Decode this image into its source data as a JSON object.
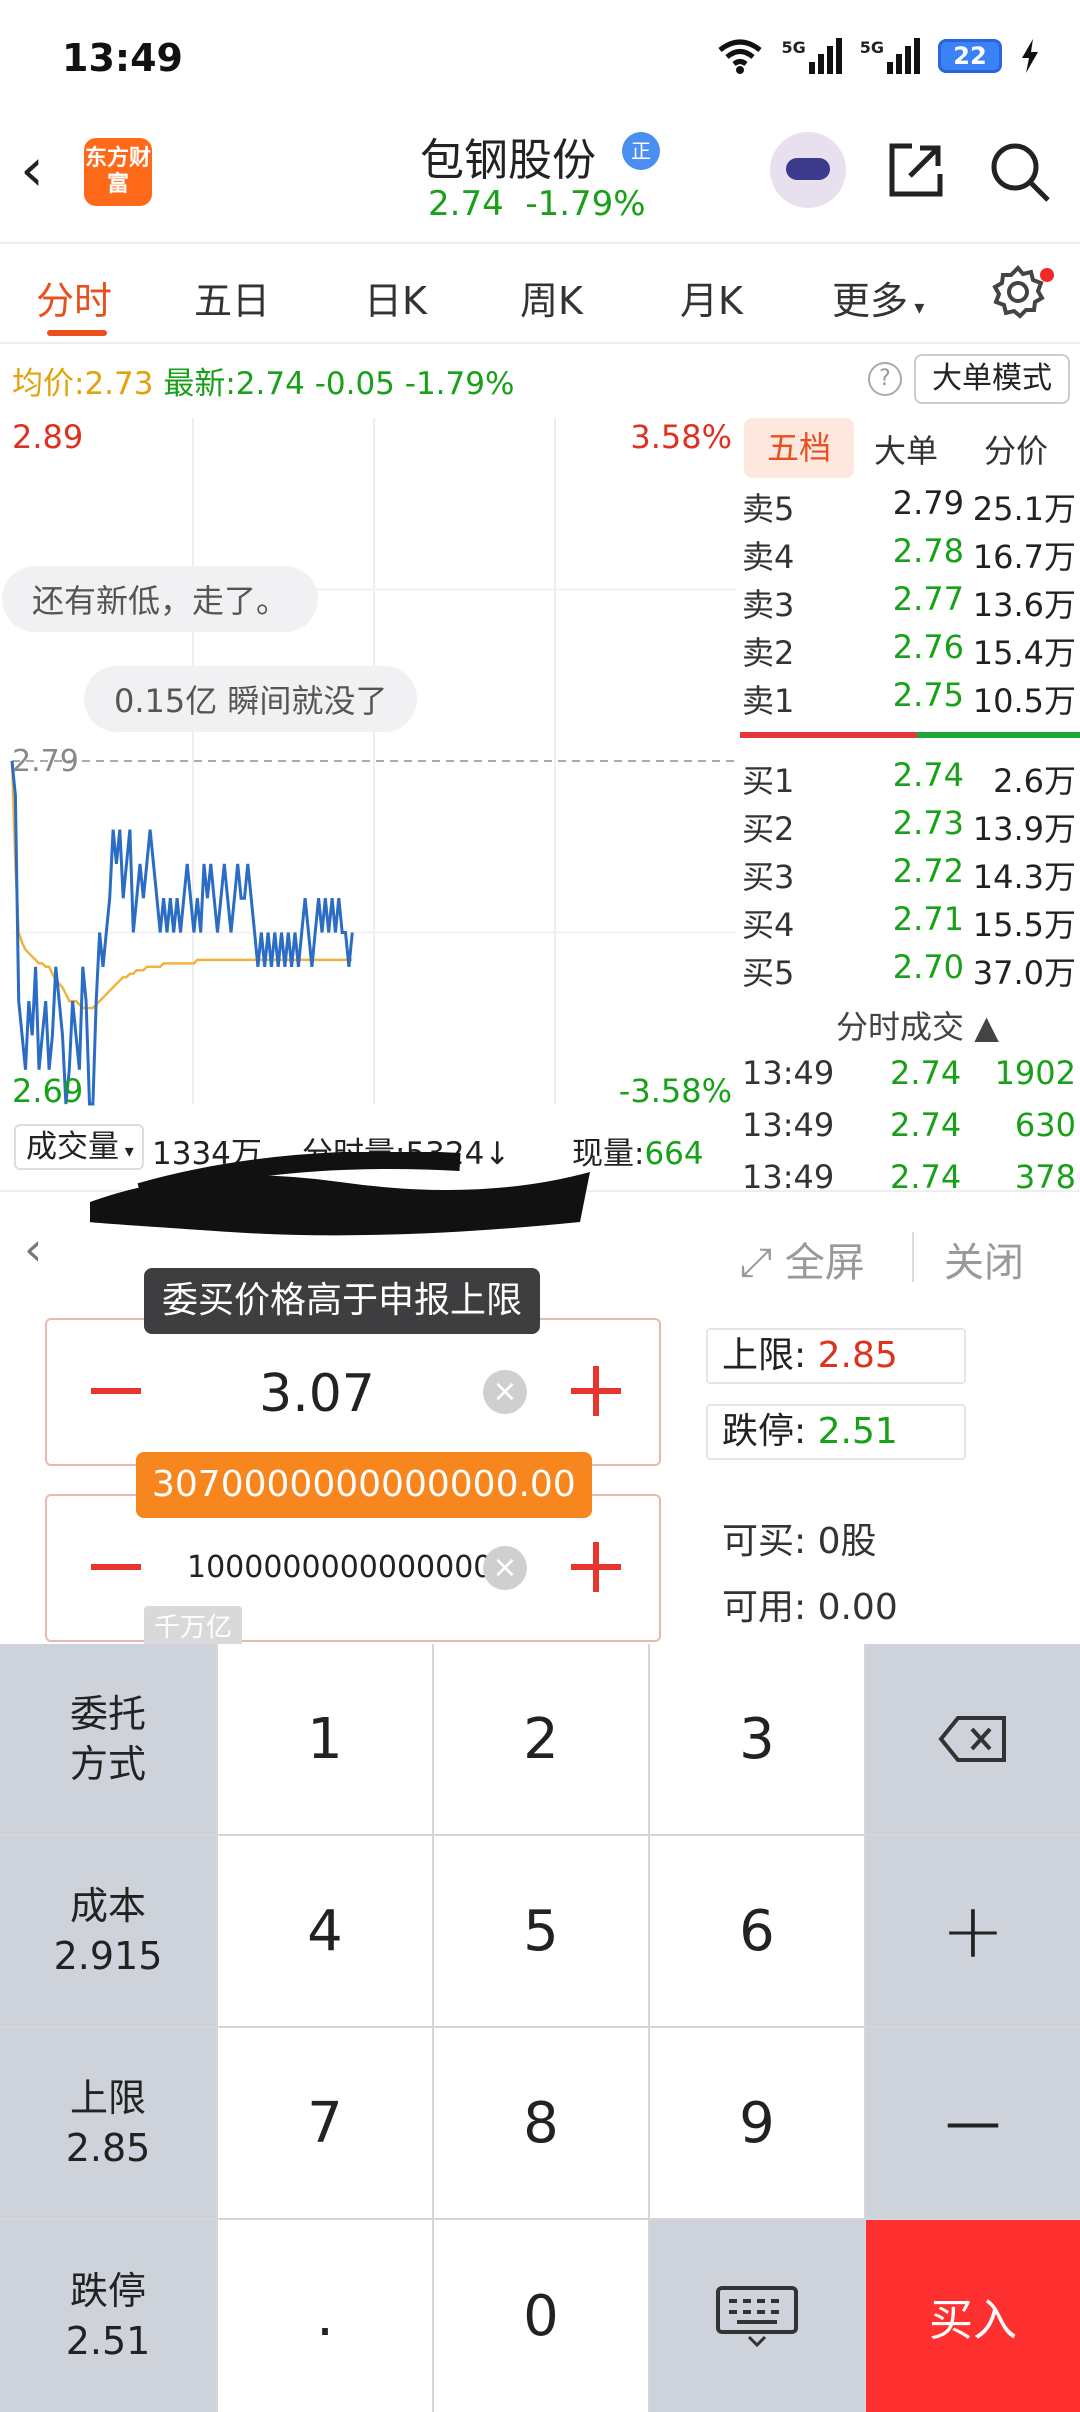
{
  "status_bar": {
    "time": "13:49",
    "battery": "22",
    "net1": "5G",
    "net2": "5G"
  },
  "header": {
    "logo": "东方财富",
    "stock_name": "包钢股份",
    "reg_badge": "正",
    "price": "2.74",
    "change_pct": "-1.79%"
  },
  "tabs": [
    {
      "label": "分时",
      "active": true
    },
    {
      "label": "五日"
    },
    {
      "label": "日K"
    },
    {
      "label": "周K"
    },
    {
      "label": "月K"
    },
    {
      "label": "更多"
    }
  ],
  "info_line": {
    "avg_label": "均价:",
    "avg_value": "2.73",
    "latest_label": "最新:",
    "latest_value": "2.74",
    "change": "-0.05",
    "change_pct": "-1.79%",
    "help": "?",
    "big_order_mode": "大单模式"
  },
  "chart_data": {
    "type": "line",
    "y_top_label": "2.89",
    "y_top_pct": "3.58%",
    "y_mid_label": "2.79",
    "y_bottom_label": "2.69",
    "y_bottom_pct": "-3.58%",
    "ylim": [
      2.69,
      2.89
    ],
    "prev_close": 2.79,
    "series": [
      {
        "values": [
          2.79,
          2.78,
          2.72,
          2.71,
          2.7,
          2.72,
          2.71,
          2.73,
          2.7,
          2.71,
          2.72,
          2.7,
          2.71,
          2.73,
          2.72,
          2.71,
          2.69,
          2.7,
          2.72,
          2.71,
          2.7,
          2.73,
          2.72,
          2.69,
          2.69,
          2.72,
          2.74,
          2.73,
          2.74,
          2.75,
          2.77,
          2.76,
          2.77,
          2.75,
          2.76,
          2.77,
          2.74,
          2.75,
          2.76,
          2.75,
          2.76,
          2.77,
          2.76,
          2.75,
          2.74,
          2.75,
          2.74,
          2.75,
          2.74,
          2.75,
          2.74,
          2.75,
          2.76,
          2.75,
          2.74,
          2.75,
          2.74,
          2.76,
          2.75,
          2.76,
          2.75,
          2.74,
          2.75,
          2.76,
          2.75,
          2.74,
          2.75,
          2.76,
          2.75,
          2.75,
          2.76,
          2.75,
          2.74,
          2.73,
          2.74,
          2.73,
          2.74,
          2.73,
          2.74,
          2.73,
          2.74,
          2.73,
          2.74,
          2.73,
          2.74,
          2.73,
          2.74,
          2.75,
          2.74,
          2.73,
          2.74,
          2.75,
          2.74,
          2.75,
          2.74,
          2.75,
          2.74,
          2.75,
          2.74,
          2.74,
          2.73,
          2.74
        ]
      },
      {
        "values": [
          2.79,
          2.76,
          2.74,
          2.737,
          2.735,
          2.734,
          2.733,
          2.732,
          2.731,
          2.731,
          2.73,
          2.73,
          2.728,
          2.726,
          2.725,
          2.724,
          2.722,
          2.72,
          2.72,
          2.72,
          2.719,
          2.718,
          2.718,
          2.718,
          2.718,
          2.719,
          2.72,
          2.721,
          2.722,
          2.723,
          2.724,
          2.725,
          2.726,
          2.727,
          2.727,
          2.728,
          2.728,
          2.729,
          2.729,
          2.729,
          2.73,
          2.73,
          2.73,
          2.73,
          2.73,
          2.731,
          2.731,
          2.731,
          2.731,
          2.731,
          2.731,
          2.731,
          2.731,
          2.731,
          2.731,
          2.732,
          2.732,
          2.732,
          2.732,
          2.732,
          2.732,
          2.732,
          2.732,
          2.732,
          2.732,
          2.732,
          2.732,
          2.732,
          2.732,
          2.732,
          2.732,
          2.732,
          2.732,
          2.732,
          2.732,
          2.732,
          2.732,
          2.732,
          2.732,
          2.732,
          2.732,
          2.732,
          2.732,
          2.732,
          2.732,
          2.732,
          2.732,
          2.732,
          2.732,
          2.732,
          2.732,
          2.732,
          2.732,
          2.732,
          2.732,
          2.732,
          2.732,
          2.732,
          2.732,
          2.732,
          2.732,
          2.732
        ]
      }
    ],
    "colors": {
      "price": "#2b6cc4",
      "avg": "#f0b43c"
    },
    "annotations": [
      "还有新低，走了。",
      "0.15亿  瞬间就没了"
    ]
  },
  "volume_bar": {
    "selector": "成交量",
    "total": "1334万",
    "minute_vol": "分时量:5324↓",
    "now_vol_label": "现量:",
    "now_vol_value": "664"
  },
  "order_book": {
    "tabs": [
      "五档",
      "大单",
      "分价"
    ],
    "asks": [
      {
        "label": "卖5",
        "price": "2.79",
        "vol": "25.1万"
      },
      {
        "label": "卖4",
        "price": "2.78",
        "vol": "16.7万"
      },
      {
        "label": "卖3",
        "price": "2.77",
        "vol": "13.6万"
      },
      {
        "label": "卖2",
        "price": "2.76",
        "vol": "15.4万"
      },
      {
        "label": "卖1",
        "price": "2.75",
        "vol": "10.5万"
      }
    ],
    "bids": [
      {
        "label": "买1",
        "price": "2.74",
        "vol": "2.6万"
      },
      {
        "label": "买2",
        "price": "2.73",
        "vol": "13.9万"
      },
      {
        "label": "买3",
        "price": "2.72",
        "vol": "14.3万"
      },
      {
        "label": "买4",
        "price": "2.71",
        "vol": "15.5万"
      },
      {
        "label": "买5",
        "price": "2.70",
        "vol": "37.0万"
      }
    ],
    "trades_title": "分时成交",
    "trades": [
      {
        "time": "13:49",
        "price": "2.74",
        "qty": "1902"
      },
      {
        "time": "13:49",
        "price": "2.74",
        "qty": "630"
      },
      {
        "time": "13:49",
        "price": "2.74",
        "qty": "378"
      }
    ]
  },
  "trade_panel": {
    "fullscreen": "全屏",
    "close": "关闭",
    "tooltip": "委买价格高于申报上限",
    "price_value": "3.07",
    "amount_tooltip": "3070000000000000.00",
    "qty_value": "1000000000000000",
    "qty_unit": "千万亿",
    "upper_limit_label": "上限:",
    "upper_limit_value": "2.85",
    "limit_down_label": "跌停:",
    "limit_down_value": "2.51",
    "can_buy": "可买: 0股",
    "available": "可用: 0.00"
  },
  "keypad": {
    "order_type": "委托\n方式",
    "cost_label": "成本",
    "cost_value": "2.915",
    "upper_label": "上限",
    "upper_value": "2.85",
    "down_label": "跌停",
    "down_value": "2.51",
    "digits": [
      "1",
      "2",
      "3",
      "4",
      "5",
      "6",
      "7",
      "8",
      "9",
      ".",
      "0"
    ],
    "plus": "+",
    "minus": "—",
    "buy": "买入"
  }
}
